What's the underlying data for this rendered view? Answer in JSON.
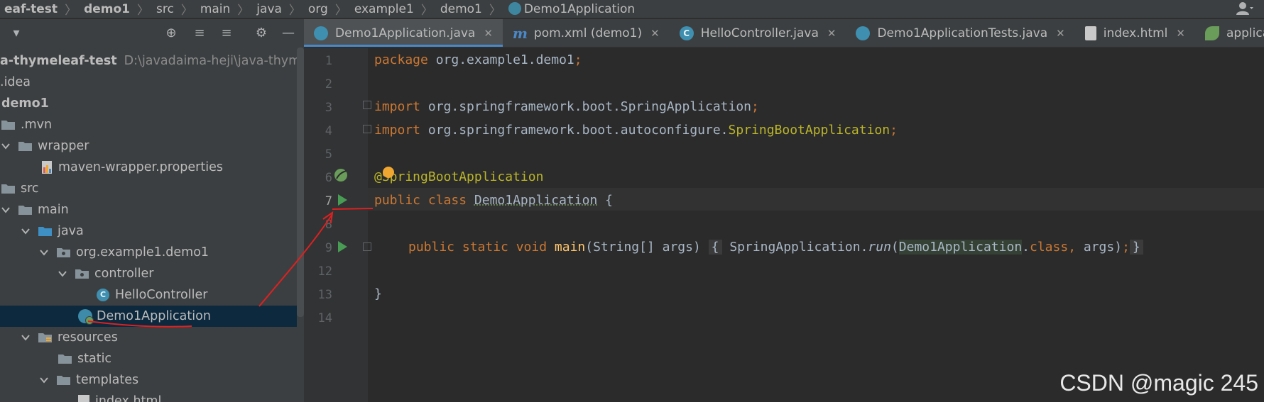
{
  "breadcrumb": {
    "items": [
      "eaf-test",
      "demo1",
      "src",
      "main",
      "java",
      "org",
      "example1",
      "demo1",
      "Demo1Application"
    ]
  },
  "project": {
    "toolbar": {
      "dropdown": "▾",
      "locate": "⊕",
      "expand": "≡",
      "collapse": "≡",
      "settings": "⚙",
      "hide": "—"
    },
    "tree": [
      {
        "label": "a-thymeleaf-test",
        "path": "D:\\javadaima-heji\\java-thymele",
        "icon": "none"
      },
      {
        "label": ".idea",
        "icon": "none"
      },
      {
        "label": "demo1",
        "icon": "none"
      },
      {
        "label": ".mvn",
        "icon": "folder-icon"
      },
      {
        "label": "wrapper",
        "icon": "folder-icon"
      },
      {
        "label": "maven-wrapper.properties",
        "icon": "properties-file-icon"
      },
      {
        "label": "src",
        "icon": "folder-icon"
      },
      {
        "label": "main",
        "icon": "folder-icon"
      },
      {
        "label": "java",
        "icon": "source-folder-icon"
      },
      {
        "label": "org.example1.demo1",
        "icon": "package-icon"
      },
      {
        "label": "controller",
        "icon": "package-icon"
      },
      {
        "label": "HelloController",
        "icon": "class-icon"
      },
      {
        "label": "Demo1Application",
        "icon": "spring-class-icon"
      },
      {
        "label": "resources",
        "icon": "resources-folder-icon"
      },
      {
        "label": "static",
        "icon": "folder-icon"
      },
      {
        "label": "templates",
        "icon": "folder-icon"
      },
      {
        "label": "index.html",
        "icon": "html-file-icon"
      }
    ]
  },
  "tabs": [
    {
      "label": "Demo1Application.java",
      "icon": "spring-class-icon",
      "active": true
    },
    {
      "label": "pom.xml (demo1)",
      "icon": "maven-icon",
      "active": false
    },
    {
      "label": "HelloController.java",
      "icon": "class-icon",
      "active": false
    },
    {
      "label": "Demo1ApplicationTests.java",
      "icon": "spring-class-icon",
      "active": false
    },
    {
      "label": "index.html",
      "icon": "html-file-icon",
      "active": false
    },
    {
      "label": "applicat",
      "icon": "spring-leaf-icon",
      "active": false
    }
  ],
  "tab_close": "✕",
  "editor": {
    "line_numbers": [
      "1",
      "2",
      "3",
      "4",
      "5",
      "6",
      "7",
      "8",
      "9",
      "12",
      "13",
      "14"
    ],
    "code": {
      "l1_kw": "package",
      "l1_rest": " org.example1.demo1",
      "l1_semi": ";",
      "l3_kw": "import",
      "l3_rest": " org.springframework.boot.SpringApplication",
      "l3_semi": ";",
      "l4_kw": "import",
      "l4_rest": " org.springframework.boot.autoconfigure.",
      "l4_cls": "SpringBootApplication",
      "l4_semi": ";",
      "l6_ann": "@SpringBootApplication",
      "l7_kw": "public class ",
      "l7_name": "Demo1Application",
      "l7_rest": " {",
      "l9_kw": "public static void ",
      "l9_fn": "main",
      "l9_params": "(String[] args) ",
      "l9_open": "{",
      "l9_call": " SpringApplication.",
      "l9_run": "run",
      "l9_paren": "(",
      "l9_cls": "Demo1Application",
      "l9_dot": ".",
      "l9_class_kw": "class",
      "l9_comma": ", ",
      "l9_args": "args",
      "l9_close": ")",
      "l9_semi": ";",
      "l9_brace": "}",
      "l13": "}"
    }
  },
  "watermark": "CSDN @magic 245",
  "colors": {
    "background": "#2b2b2b",
    "panel": "#3c3f41",
    "keyword": "#cc7832",
    "annotation": "#bbb529",
    "method": "#ffc66d",
    "selection": "#0d293e",
    "run_green": "#499c54",
    "annotation_red": "#e02020"
  }
}
